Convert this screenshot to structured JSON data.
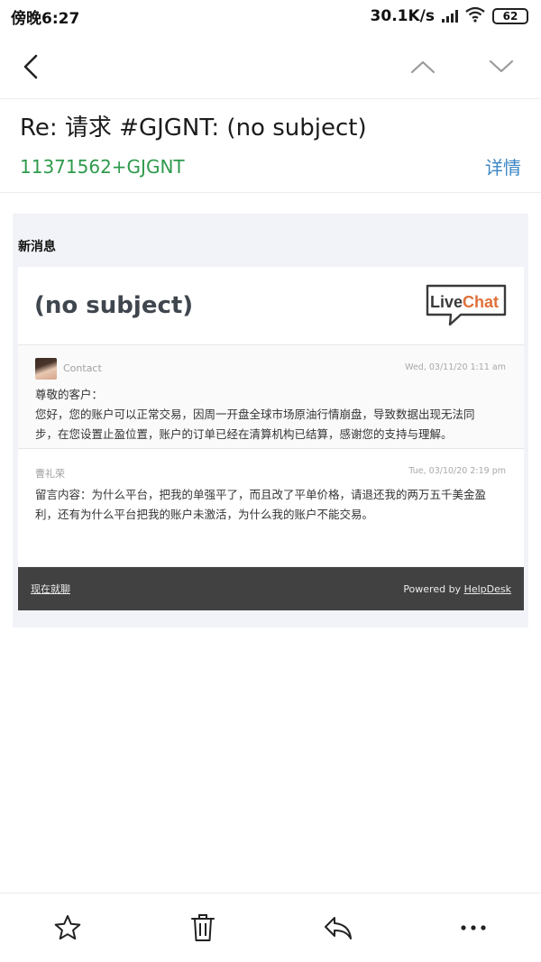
{
  "status_bar": {
    "time": "傍晚6:27",
    "network_speed": "30.1K/s",
    "battery": "62"
  },
  "nav": {
    "back_icon": "back-arrow-icon",
    "prev_icon": "chevron-up-icon",
    "next_icon": "chevron-down-icon"
  },
  "email": {
    "subject": "Re: 请求 #GJGNT: (no subject)",
    "sender": "11371562+GJGNT",
    "details_label": "详情"
  },
  "content": {
    "section_label": "新消息",
    "card_title": "(no subject)",
    "logo_text": "LiveChat",
    "messages": [
      {
        "from": "Contact",
        "time": "Wed, 03/11/20 1:11 am",
        "lines": [
          "尊敬的客户：",
          "您好，您的账户可以正常交易，因周一开盘全球市场原油行情崩盘，导致数据出现无法同",
          "步，在您设置止盈位置，账户的订单已经在清算机构已结算，感谢您的支持与理解。"
        ]
      },
      {
        "from": "曹礼荣",
        "time": "Tue, 03/10/20 2:19 pm",
        "lines": [
          "留言内容：为什么平台，把我的单强平了，而且改了平单价格，请退还我的两万五千美金盈",
          "利，还有为什么平台把我的账户未激活，为什么我的账户不能交易。"
        ]
      }
    ],
    "footer_link": "现在就聊",
    "powered_by": "Powered by",
    "powered_brand": "HelpDesk"
  },
  "toolbar": {
    "star_icon": "star-icon",
    "delete_icon": "trash-icon",
    "reply_icon": "reply-icon",
    "more_icon": "more-icon"
  },
  "colors": {
    "sender_green": "#2e9a4c",
    "details_blue": "#3b86c4",
    "footer_dark": "#414141",
    "logo_orange": "#e0703a"
  }
}
